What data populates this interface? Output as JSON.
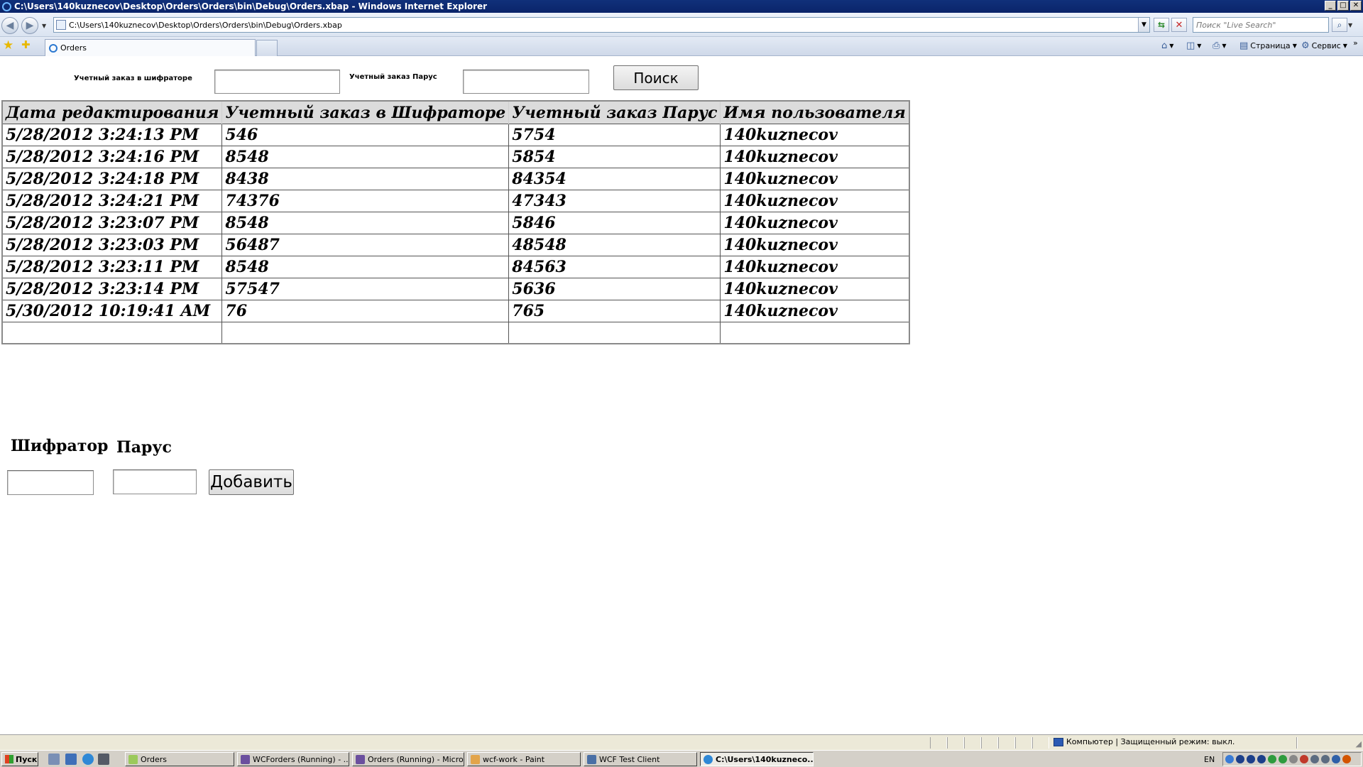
{
  "window": {
    "title": "C:\\Users\\140kuznecov\\Desktop\\Orders\\Orders\\bin\\Debug\\Orders.xbap - Windows Internet Explorer",
    "controls": {
      "minimize": "_",
      "maximize": "□",
      "close": "✕"
    }
  },
  "browser": {
    "address": "C:\\Users\\140kuznecov\\Desktop\\Orders\\Orders\\bin\\Debug\\Orders.xbap",
    "search_placeholder": "Поиск \"Live Search\"",
    "tab_label": "Orders",
    "commands": {
      "page": "Страница",
      "tools": "Сервис",
      "more": "»"
    }
  },
  "search_form": {
    "shifrator_label": "Учетный заказ в шифраторе",
    "shifrator_value": "",
    "parus_label": "Учетный заказ Парус",
    "parus_value": "",
    "search_button": "Поиск"
  },
  "grid": {
    "headers": [
      "Дата редактирования",
      "Учетный заказ в Шифраторе",
      "Учетный заказ Парус",
      "Имя пользователя"
    ],
    "rows": [
      [
        "5/28/2012 3:24:13 PM",
        "546",
        "5754",
        "140kuznecov"
      ],
      [
        "5/28/2012 3:24:16 PM",
        "8548",
        "5854",
        "140kuznecov"
      ],
      [
        "5/28/2012 3:24:18 PM",
        "8438",
        "84354",
        "140kuznecov"
      ],
      [
        "5/28/2012 3:24:21 PM",
        "74376",
        "47343",
        "140kuznecov"
      ],
      [
        "5/28/2012 3:23:07 PM",
        "8548",
        "5846",
        "140kuznecov"
      ],
      [
        "5/28/2012 3:23:03 PM",
        "56487",
        "48548",
        "140kuznecov"
      ],
      [
        "5/28/2012 3:23:11 PM",
        "8548",
        "84563",
        "140kuznecov"
      ],
      [
        "5/28/2012 3:23:14 PM",
        "57547",
        "5636",
        "140kuznecov"
      ],
      [
        "5/30/2012 10:19:41 AM",
        "76",
        "765",
        "140kuznecov"
      ],
      [
        "",
        "",
        "",
        ""
      ]
    ]
  },
  "add_form": {
    "shifrator_label": "Шифратор",
    "shifrator_value": "",
    "parus_label": "Парус",
    "parus_value": "",
    "add_button": "Добавить"
  },
  "statusbar": {
    "zone": "Компьютер | Защищенный режим: выкл."
  },
  "taskbar": {
    "start_label": "Пуск",
    "tasks": [
      "Orders",
      "WCForders (Running) - ...",
      "Orders (Running) - Micro...",
      "wcf-work - Paint",
      "WCF Test Client",
      "C:\\Users\\140kuzneco..."
    ],
    "lang": "EN"
  }
}
